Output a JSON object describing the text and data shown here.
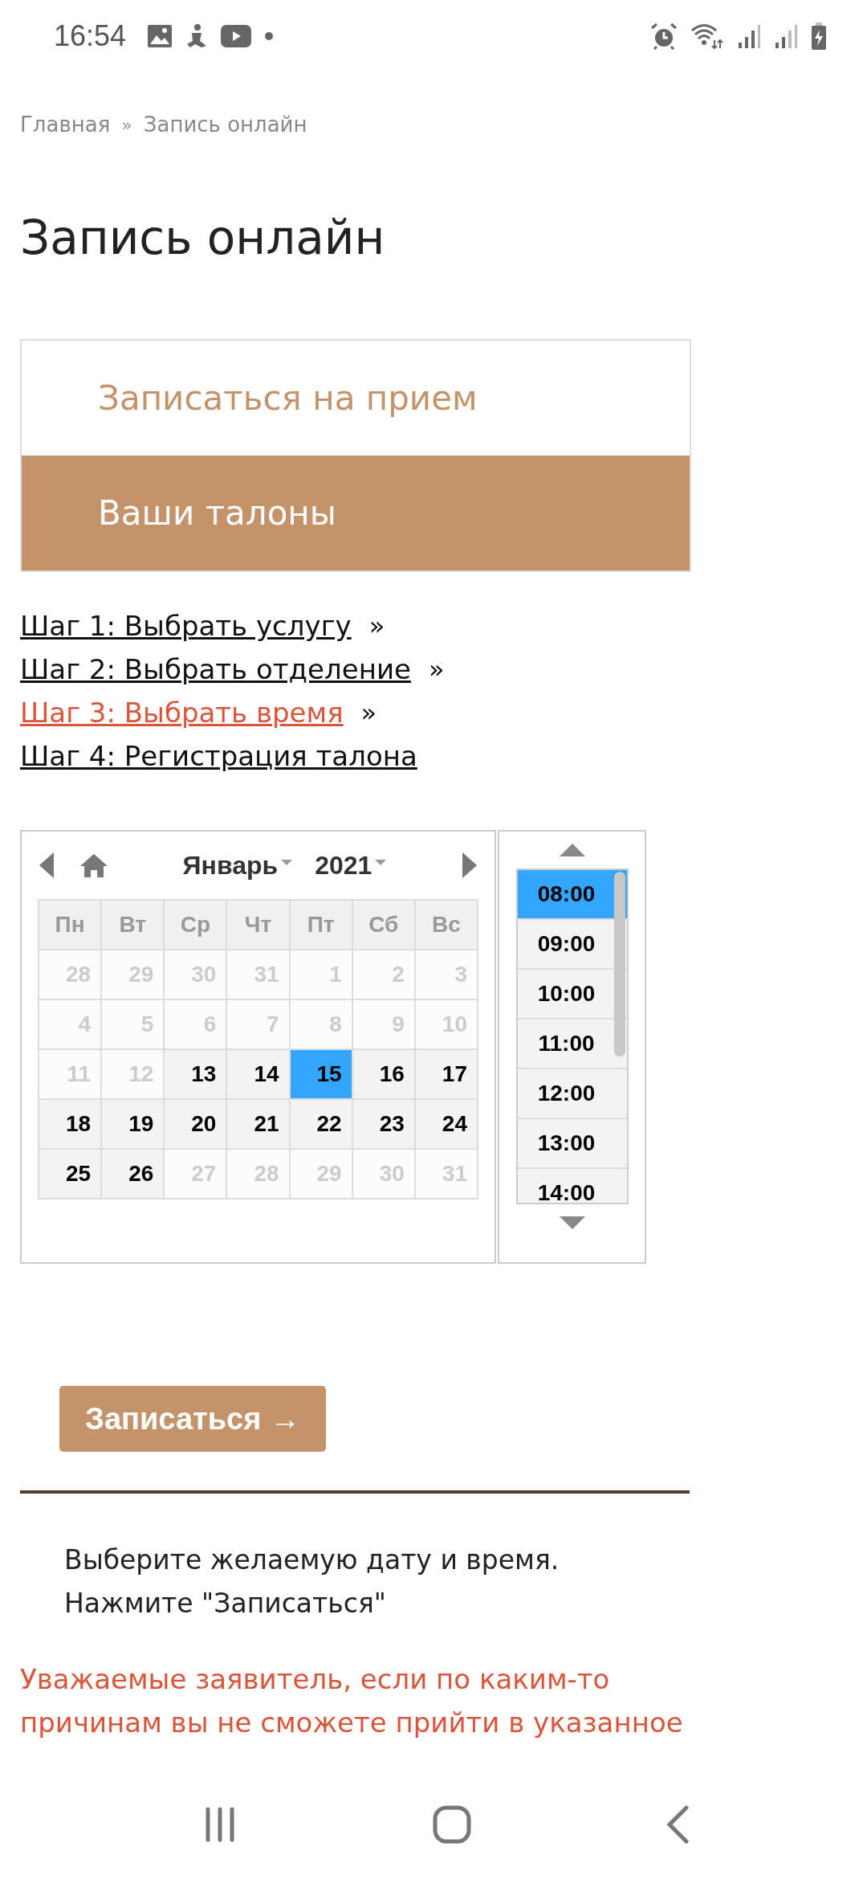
{
  "status_bar": {
    "time": "16:54"
  },
  "breadcrumb": [
    {
      "label": "Главная"
    },
    {
      "label": "»",
      "kind": "separator"
    },
    {
      "label": "Запись онлайн"
    }
  ],
  "title": "Запись онлайн",
  "tabs": [
    {
      "label": "Записаться на прием",
      "selected": false
    },
    {
      "label": "Ваши талоны",
      "selected": true
    }
  ],
  "steps": [
    {
      "label": "Шаг 1: Выбрать услугу",
      "separator": "»",
      "current": false
    },
    {
      "label": "Шаг 2: Выбрать отделение",
      "separator": "»",
      "current": false
    },
    {
      "label": "Шаг 3: Выбрать время",
      "separator": "»",
      "current": true
    },
    {
      "label": "Шаг 4: Регистрация талона",
      "current": false
    }
  ],
  "calendar": {
    "month": "Январь",
    "year": "2021",
    "weekdays": [
      "Пн",
      "Вт",
      "Ср",
      "Чт",
      "Пт",
      "Сб",
      "Вс"
    ],
    "weeks": [
      [
        {
          "day": "28",
          "available": false,
          "selected": false
        },
        {
          "day": "29",
          "available": false,
          "selected": false
        },
        {
          "day": "30",
          "available": false,
          "selected": false
        },
        {
          "day": "31",
          "available": false,
          "selected": false
        },
        {
          "day": "1",
          "available": false,
          "selected": false
        },
        {
          "day": "2",
          "available": false,
          "selected": false
        },
        {
          "day": "3",
          "available": false,
          "selected": false
        }
      ],
      [
        {
          "day": "4",
          "available": false,
          "selected": false
        },
        {
          "day": "5",
          "available": false,
          "selected": false
        },
        {
          "day": "6",
          "available": false,
          "selected": false
        },
        {
          "day": "7",
          "available": false,
          "selected": false
        },
        {
          "day": "8",
          "available": false,
          "selected": false
        },
        {
          "day": "9",
          "available": false,
          "selected": false
        },
        {
          "day": "10",
          "available": false,
          "selected": false
        }
      ],
      [
        {
          "day": "11",
          "available": false,
          "selected": false
        },
        {
          "day": "12",
          "available": false,
          "selected": false
        },
        {
          "day": "13",
          "available": true,
          "selected": false
        },
        {
          "day": "14",
          "available": true,
          "selected": false
        },
        {
          "day": "15",
          "available": true,
          "selected": true
        },
        {
          "day": "16",
          "available": true,
          "selected": false
        },
        {
          "day": "17",
          "available": true,
          "selected": false
        }
      ],
      [
        {
          "day": "18",
          "available": true,
          "selected": false
        },
        {
          "day": "19",
          "available": true,
          "selected": false
        },
        {
          "day": "20",
          "available": true,
          "selected": false
        },
        {
          "day": "21",
          "available": true,
          "selected": false
        },
        {
          "day": "22",
          "available": true,
          "selected": false
        },
        {
          "day": "23",
          "available": true,
          "selected": false
        },
        {
          "day": "24",
          "available": true,
          "selected": false
        }
      ],
      [
        {
          "day": "25",
          "available": true,
          "selected": false
        },
        {
          "day": "26",
          "available": true,
          "selected": false
        },
        {
          "day": "27",
          "available": false,
          "selected": false
        },
        {
          "day": "28",
          "available": false,
          "selected": false
        },
        {
          "day": "29",
          "available": false,
          "selected": false
        },
        {
          "day": "30",
          "available": false,
          "selected": false
        },
        {
          "day": "31",
          "available": false,
          "selected": false
        }
      ]
    ]
  },
  "times": [
    {
      "label": "08:00",
      "selected": true
    },
    {
      "label": "09:00",
      "selected": false
    },
    {
      "label": "10:00",
      "selected": false
    },
    {
      "label": "11:00",
      "selected": false
    },
    {
      "label": "12:00",
      "selected": false
    },
    {
      "label": "13:00",
      "selected": false
    },
    {
      "label": "14:00",
      "selected": false
    }
  ],
  "submit_button": {
    "label": "Записаться →"
  },
  "instructions": [
    "Выберите желаемую дату и время.",
    "Нажмите \"Записаться\""
  ],
  "warning": "Уважаемые заявитель, если по каким-то причинам вы не сможете прийти в указанное"
}
